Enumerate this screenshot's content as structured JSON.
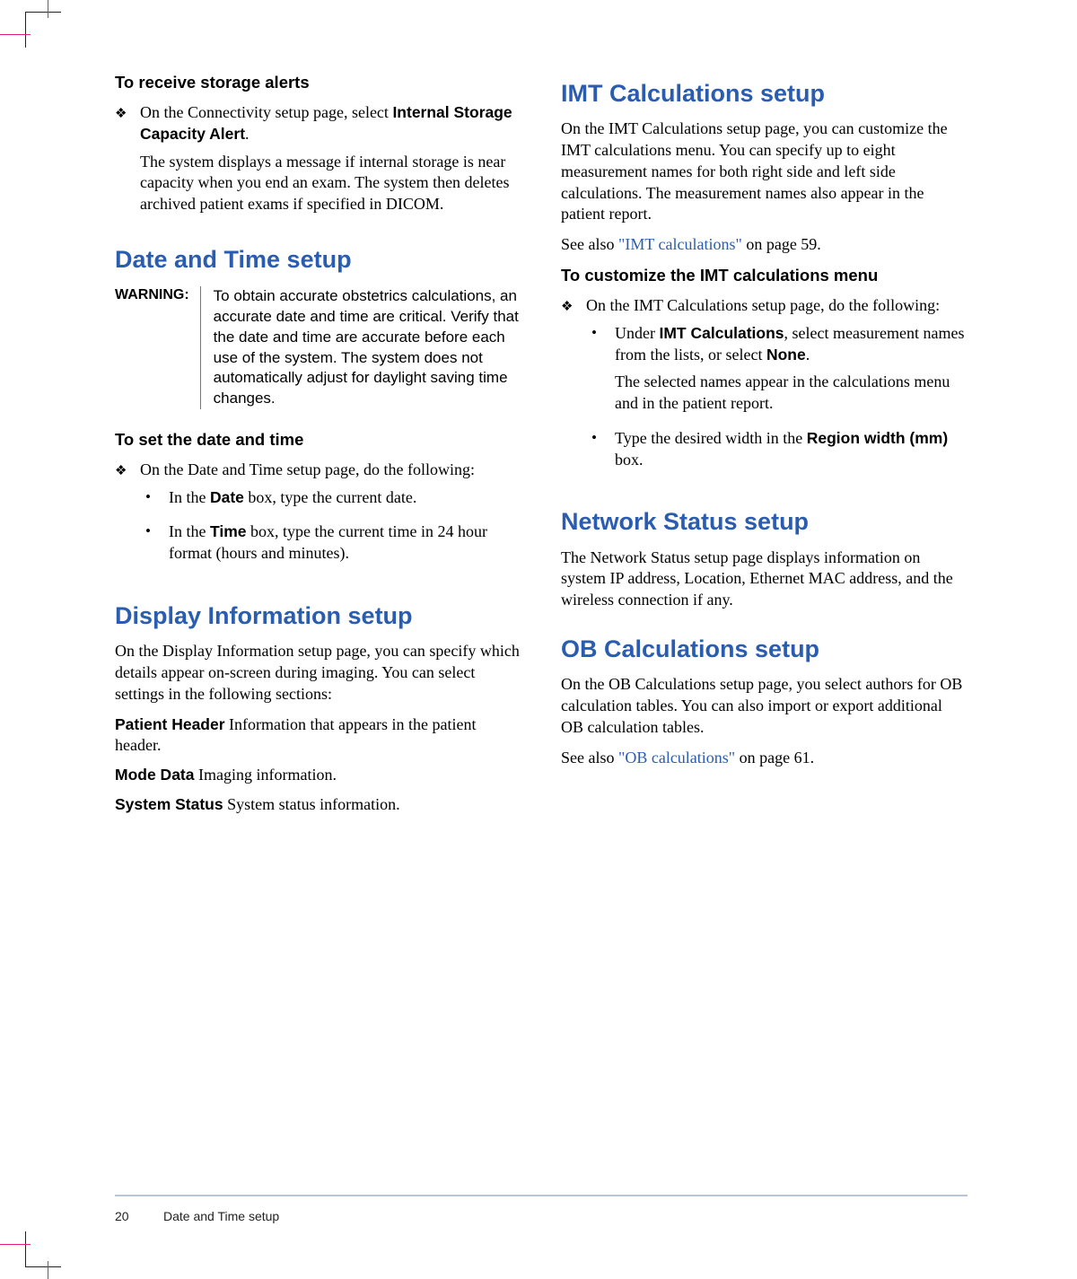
{
  "footer": {
    "page": "20",
    "section": "Date and Time setup"
  },
  "left": {
    "h_storage": "To receive storage alerts",
    "storage_p1a": "On the Connectivity setup page, select ",
    "storage_p1b": "Internal Storage Capacity Alert",
    "storage_p1c": ".",
    "storage_p2": "The system displays a message if internal storage is near capacity when you end an exam. The system then deletes archived patient exams if specified in DICOM.",
    "h_date": "Date and Time setup",
    "warn_label": "WARNING:",
    "warn_text": "To obtain accurate obstetrics calculations, an accurate date and time are critical. Verify that the date and time are accurate before each use of the system. The system does not automatically adjust for daylight saving time changes.",
    "h_setdt": "To set the date and time",
    "setdt_p1": "On the Date and Time setup page, do the following:",
    "setdt_b1a": "In the ",
    "setdt_b1b": "Date",
    "setdt_b1c": " box, type the current date.",
    "setdt_b2a": "In the ",
    "setdt_b2b": "Time",
    "setdt_b2c": " box, type the current time in 24 hour format (hours and minutes).",
    "h_disp": "Display Information setup",
    "disp_p1": "On the Display Information setup page, you can specify which details appear on-screen during imaging. You can select settings in the following sections:",
    "def_ph_l": "Patient Header",
    "def_ph_t": " Information that appears in the patient header.",
    "def_md_l": "Mode Data",
    "def_md_t": " Imaging information.",
    "def_ss_l": "System Status",
    "def_ss_t": " System status information."
  },
  "right": {
    "h_imt": "IMT Calculations setup",
    "imt_p1": "On the IMT Calculations setup page, you can customize the IMT calculations menu. You can specify up to eight measurement names for both right side and left side calculations. The measurement names also appear in the patient report.",
    "imt_see_a": "See also ",
    "imt_see_link": "\"IMT calculations\"",
    "imt_see_b": " on page 59.",
    "h_imtmenu": "To customize the IMT calculations menu",
    "imt_b1": "On the IMT Calculations setup page, do the following:",
    "imt_s1a": "Under ",
    "imt_s1b": "IMT Calculations",
    "imt_s1c": ", select measurement names from the lists, or select ",
    "imt_s1d": "None",
    "imt_s1e": ".",
    "imt_s1f": "The selected names appear in the calculations menu and in the patient report.",
    "imt_s2a": "Type the desired width in the ",
    "imt_s2b": "Region width (mm)",
    "imt_s2c": " box.",
    "h_net": "Network Status setup",
    "net_p1": "The Network Status setup page displays information on system IP address, Location, Ethernet MAC address, and the wireless connection if any.",
    "h_ob": "OB Calculations setup",
    "ob_p1": "On the OB Calculations setup page, you select authors for OB calculation tables. You can also import or export additional OB calculation tables.",
    "ob_see_a": "See also ",
    "ob_see_link": "\"OB calculations\"",
    "ob_see_b": " on page 61."
  }
}
